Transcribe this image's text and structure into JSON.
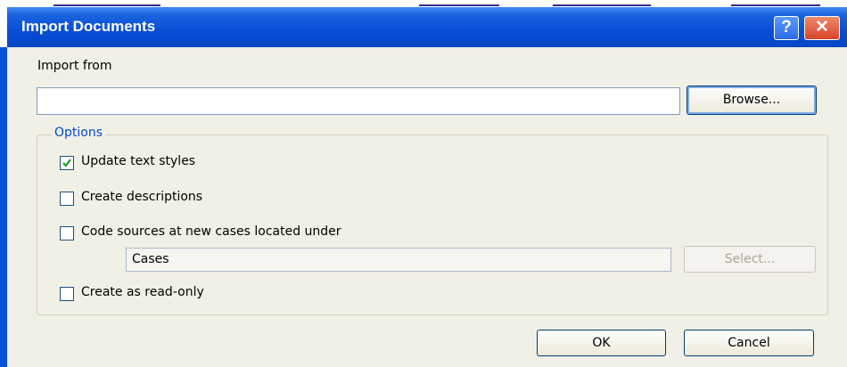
{
  "dialog": {
    "title": "Import Documents",
    "help_glyph": "?",
    "close_glyph": "✕",
    "icons": {
      "help": "question-mark-icon",
      "close": "close-x-icon",
      "check": "checkmark-icon"
    }
  },
  "import_from": {
    "label": "Import from",
    "value": "",
    "browse_label": "Browse..."
  },
  "options": {
    "legend": "Options",
    "update_text_styles": {
      "label": "Update text styles",
      "checked": true
    },
    "create_descriptions": {
      "label": "Create descriptions",
      "checked": false
    },
    "code_sources": {
      "label": "Code sources at new cases located under",
      "checked": false
    },
    "cases_path": {
      "value": "Cases",
      "enabled": false
    },
    "select_label": "Select...",
    "create_read_only": {
      "label": "Create as read-only",
      "checked": false
    }
  },
  "footer": {
    "ok_label": "OK",
    "cancel_label": "Cancel"
  },
  "colors": {
    "titlebar": "#0a50d6",
    "dialog_bg": "#f1f0e6",
    "legend_text": "#0046d5",
    "check_green": "#21a121"
  }
}
